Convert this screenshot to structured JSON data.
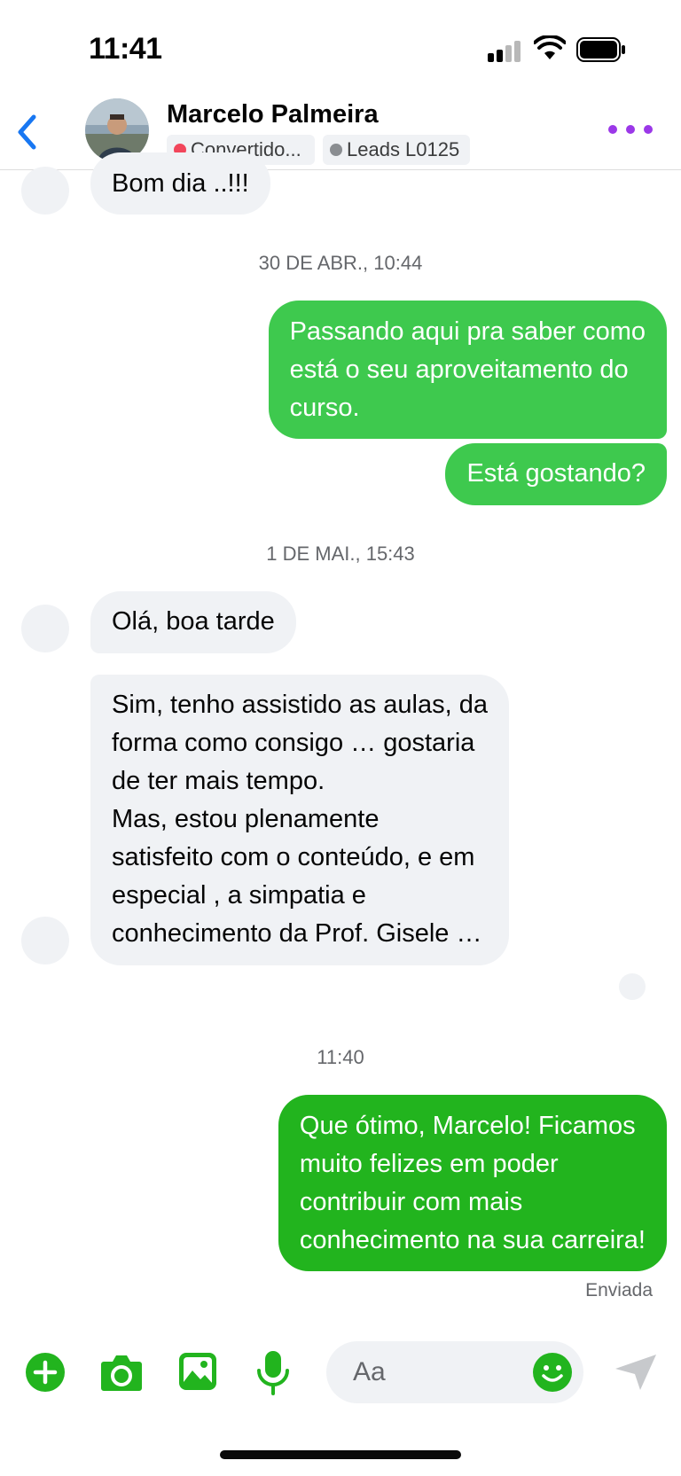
{
  "status_bar": {
    "time": "11:41"
  },
  "header": {
    "contact_name": "Marcelo Palmeira",
    "tags": [
      {
        "label": "Convertido...",
        "dot_color": "#f2465b"
      },
      {
        "label": "Leads L0125",
        "dot_color": "#8a8d91"
      }
    ],
    "accent_color": "#1877f2",
    "more_color": "#9b38e8"
  },
  "chat": {
    "earlier_incoming": "Bom dia ..!!!",
    "groups": [
      {
        "timestamp": "30 DE ABR., 10:44",
        "messages": [
          {
            "direction": "outgoing",
            "lines": [
              "Passando aqui pra saber como",
              "está o seu aproveitamento do",
              "curso."
            ]
          },
          {
            "direction": "outgoing",
            "lines": [
              "Está gostando?"
            ]
          }
        ]
      },
      {
        "timestamp": "1 DE MAI., 15:43",
        "messages": [
          {
            "direction": "incoming",
            "lines": [
              "Olá, boa tarde"
            ]
          },
          {
            "direction": "incoming",
            "lines": [
              "Sim, tenho assistido as aulas, da",
              "forma como consigo … gostaria",
              "de ter mais tempo.",
              "Mas, estou plenamente",
              "satisfeito com o conteúdo, e em",
              "especial , a simpatia e",
              "conhecimento da Prof. Gisele …"
            ]
          }
        ]
      },
      {
        "timestamp": "11:40",
        "messages": [
          {
            "direction": "outgoing",
            "lines": [
              "Que ótimo, Marcelo! Ficamos",
              "muito felizes em poder",
              "contribuir com mais",
              "conhecimento na sua carreira!"
            ]
          }
        ]
      }
    ],
    "delivery_status": "Enviada",
    "outgoing_color": "#3ec94e",
    "latest_outgoing_color": "#22b41e",
    "incoming_color": "#f0f2f5"
  },
  "composer": {
    "placeholder": "Aa",
    "icons": [
      "plus-circle-icon",
      "camera-icon",
      "image-icon",
      "microphone-icon",
      "emoji-icon",
      "send-icon"
    ],
    "icon_color": "#22b41e"
  }
}
